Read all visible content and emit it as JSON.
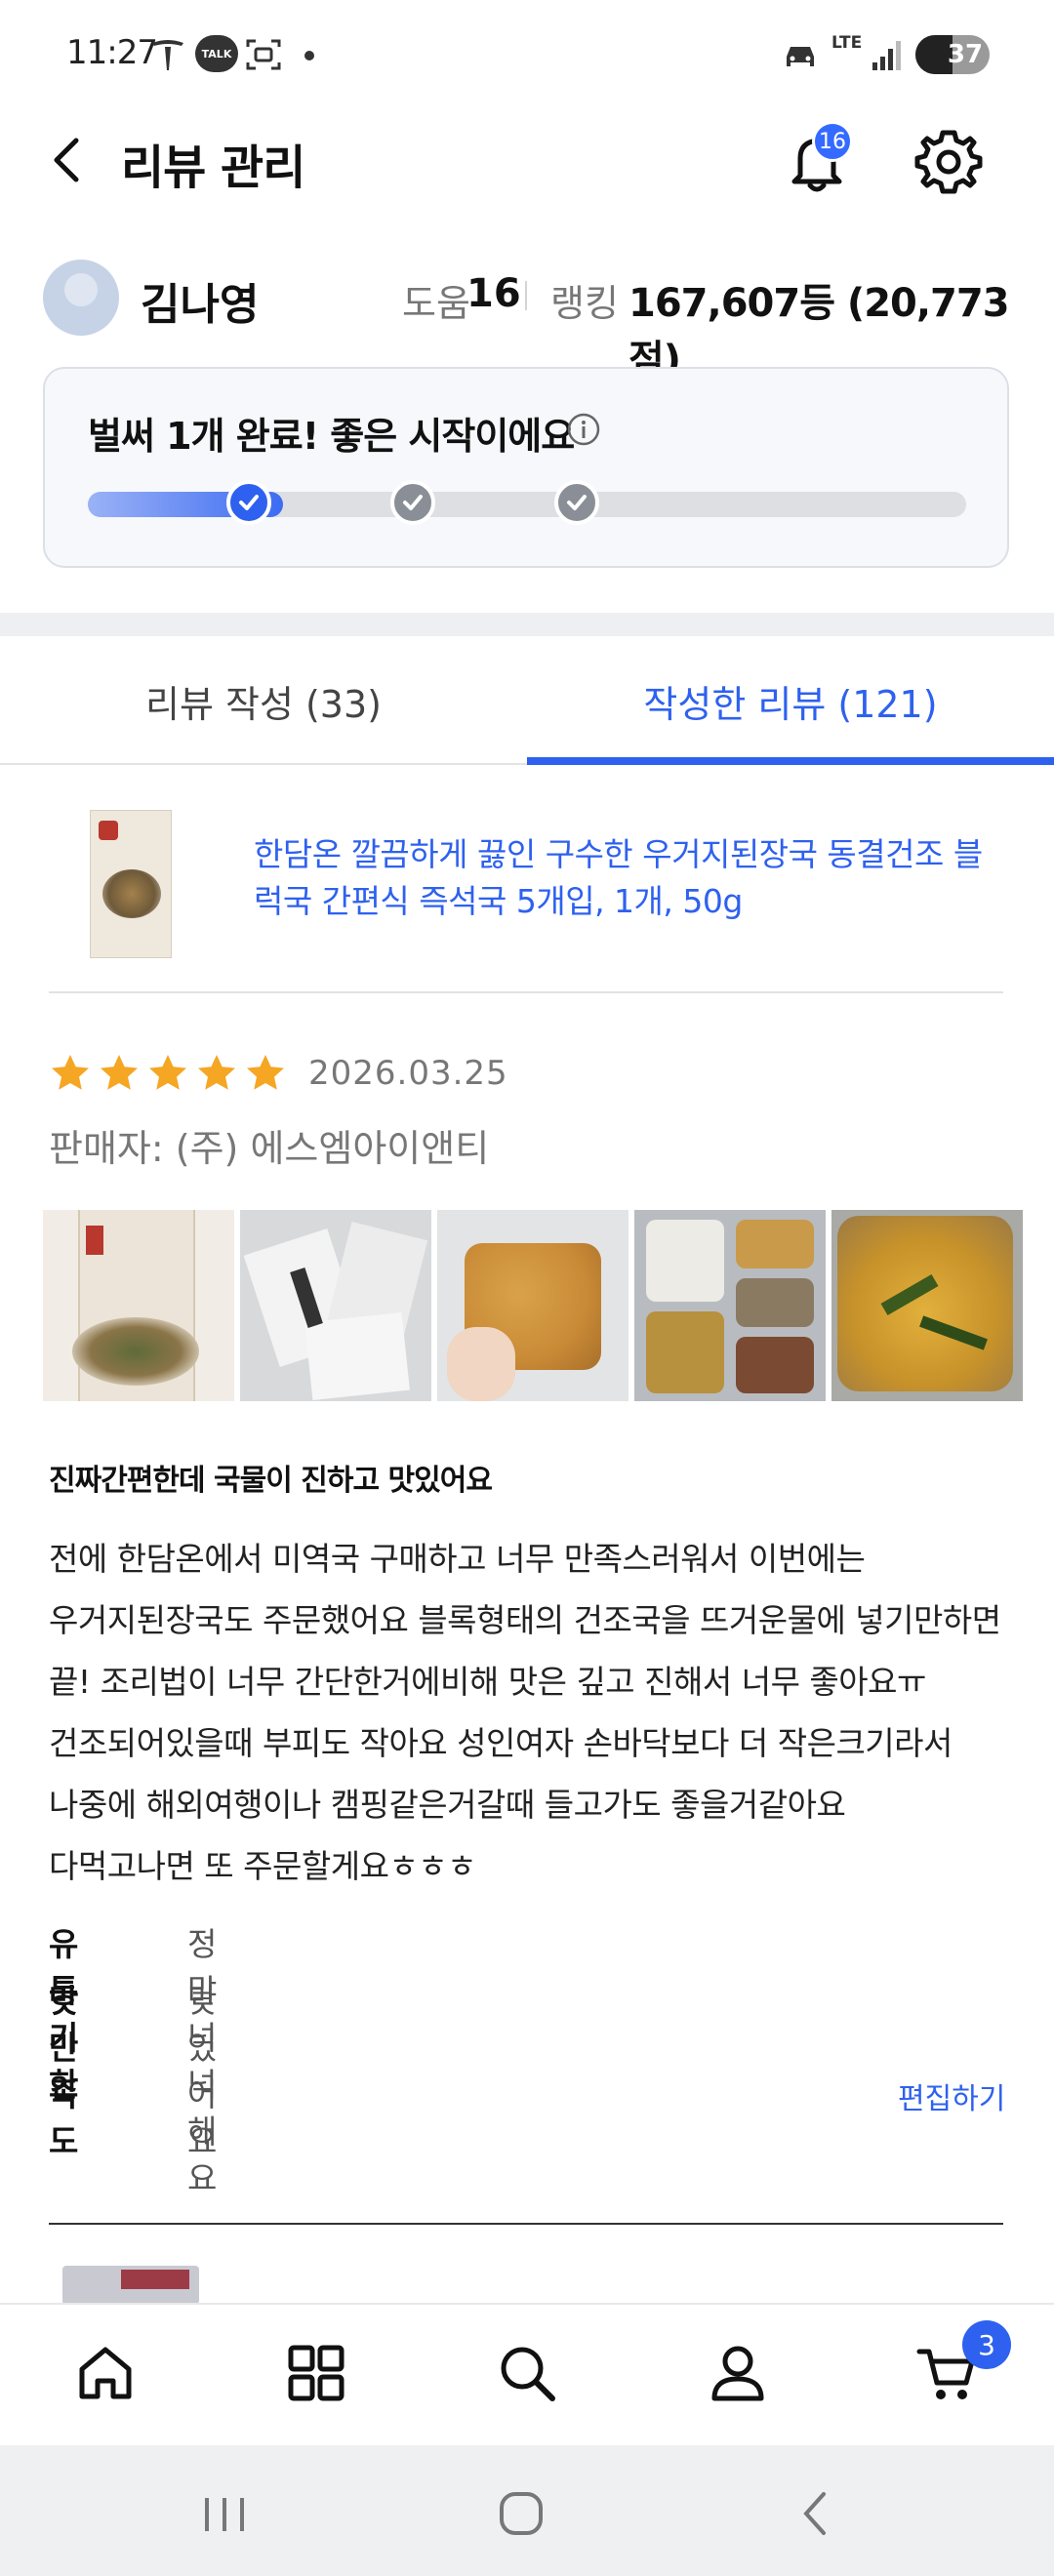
{
  "status_bar": {
    "time": "11:27",
    "talk_label": "TALK",
    "network": "LTE",
    "battery": "37"
  },
  "header": {
    "title": "리뷰 관리",
    "notification_count": "16"
  },
  "profile": {
    "name": "김나영",
    "help_label": "도움",
    "help_count": "16",
    "rank_label": "랭킹",
    "rank_value": "167,607등 (20,773점)"
  },
  "progress": {
    "title": "벌써 1개 완료! 좋은 시작이에요",
    "completed_fraction": 0.33,
    "steps": [
      {
        "done": true
      },
      {
        "done": false
      },
      {
        "done": false
      }
    ]
  },
  "tabs": [
    {
      "label": "리뷰 작성 (33)",
      "active": false
    },
    {
      "label": "작성한 리뷰 (121)",
      "active": true
    }
  ],
  "review": {
    "product_name": "한담온 깔끔하게 끓인 구수한 우거지된장국 동결건조 블럭국 간편식 즉석국 5개입, 1개, 50g",
    "rating": 5,
    "date": "2026.03.25",
    "seller": "판매자: (주) 에스엠아이앤티",
    "photo_count": 5,
    "title": "진짜간편한데 국물이 진하고 맛있어요",
    "body_lines": [
      "전에 한담온에서 미역국 구매하고 너무 만족스러워서 이번에는",
      "우거지된장국도 주문했어요 블록형태의 건조국을 뜨거운물에 넣기만하면",
      "끝! 조리법이 너무 간단한거에비해 맛은 깊고 진해서 너무 좋아요ㅠ",
      "건조되어있을때 부피도 작아요 성인여자 손바닥보다 더 작은크기라서",
      "나중에 해외여행이나 캠핑같은거갈때 들고가도 좋을거같아요",
      "다먹고나면 또 주문할게요ㅎㅎㅎ"
    ],
    "attributes": [
      {
        "label": "유통기한",
        "value": "정말 넉넉해요"
      },
      {
        "label": "맛 만족도",
        "value": "맛있어요"
      }
    ],
    "edit_label": "편집하기"
  },
  "bottom_nav": {
    "items": [
      "home-icon",
      "categories-icon",
      "search-icon",
      "account-icon",
      "cart-icon"
    ],
    "cart_count": "3"
  },
  "colors": {
    "accent": "#2e61ef",
    "star": "#f5a623",
    "muted": "#777777"
  }
}
